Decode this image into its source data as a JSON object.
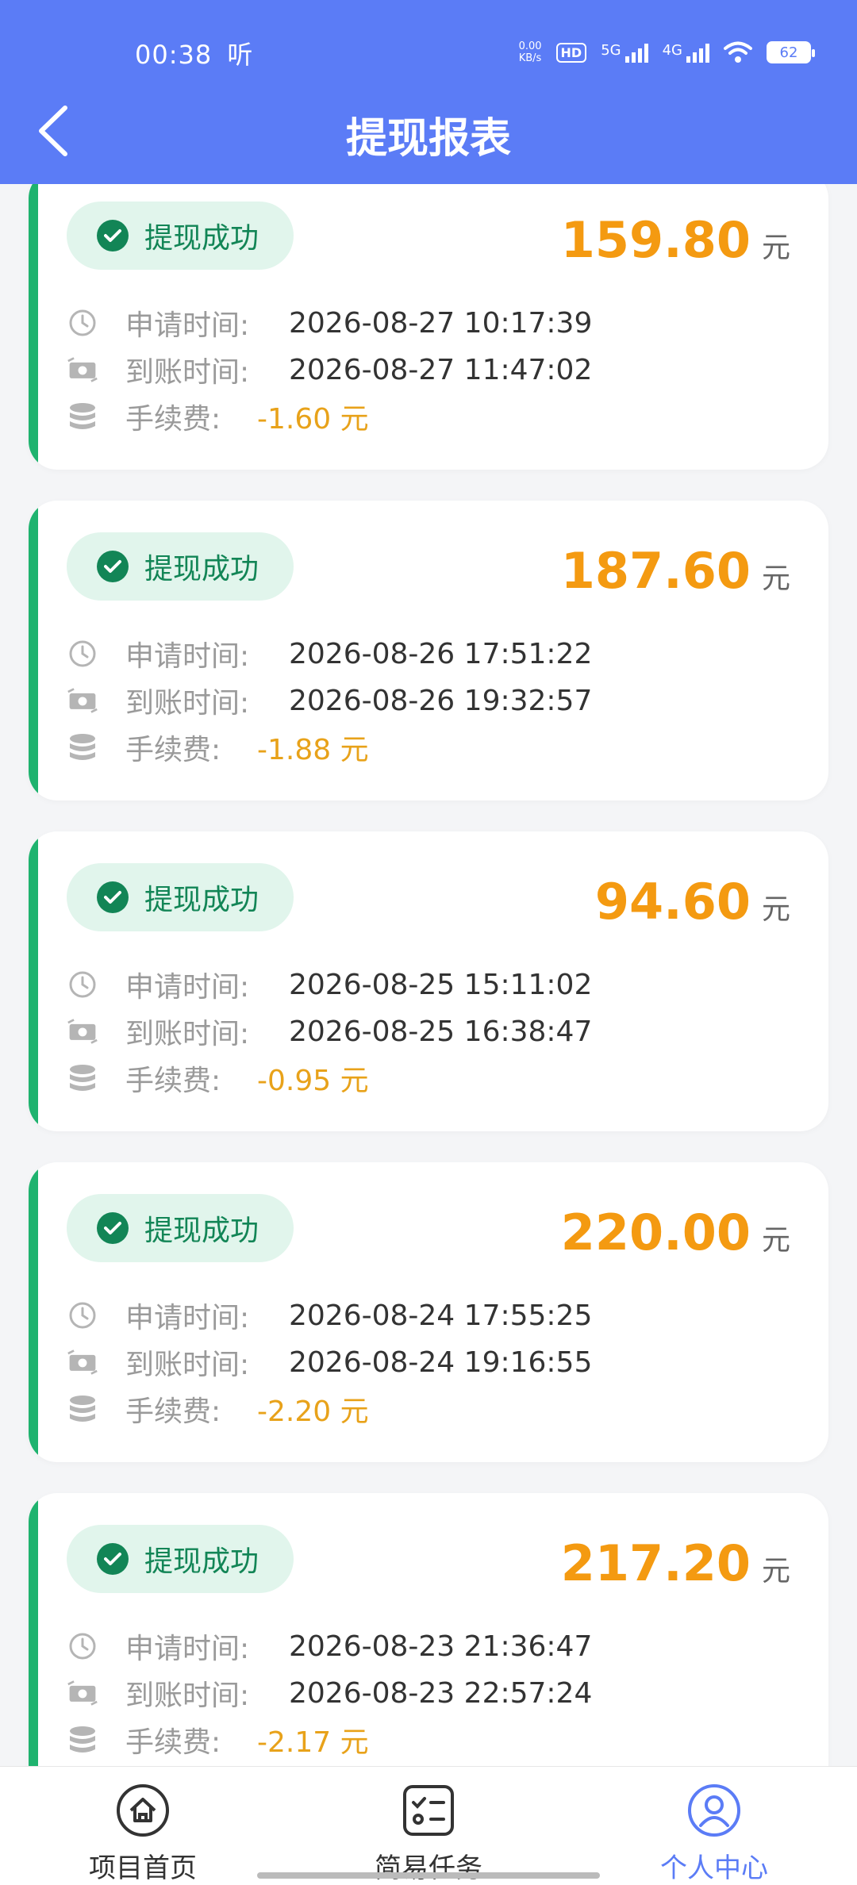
{
  "status_bar": {
    "time": "00:38",
    "extra": "听",
    "net_speed_top": "0.00",
    "net_speed_bottom": "KB/s",
    "hd_label": "HD",
    "sig1_label": "5G",
    "sig2_label": "4G",
    "battery": "62"
  },
  "header": {
    "title": "提现报表"
  },
  "labels": {
    "status": "提现成功",
    "apply_time": "申请时间:",
    "arrive_time": "到账时间:",
    "fee": "手续费:",
    "unit": "元"
  },
  "records": [
    {
      "amount": "159.80",
      "apply_time": "2026-08-27 10:17:39",
      "arrive_time": "2026-08-27 11:47:02",
      "fee": "-1.60 元"
    },
    {
      "amount": "187.60",
      "apply_time": "2026-08-26 17:51:22",
      "arrive_time": "2026-08-26 19:32:57",
      "fee": "-1.88 元"
    },
    {
      "amount": "94.60",
      "apply_time": "2026-08-25 15:11:02",
      "arrive_time": "2026-08-25 16:38:47",
      "fee": "-0.95 元"
    },
    {
      "amount": "220.00",
      "apply_time": "2026-08-24 17:55:25",
      "arrive_time": "2026-08-24 19:16:55",
      "fee": "-2.20 元"
    },
    {
      "amount": "217.20",
      "apply_time": "2026-08-23 21:36:47",
      "arrive_time": "2026-08-23 22:57:24",
      "fee": "-2.17 元"
    }
  ],
  "bottom_nav": [
    {
      "label": "项目首页",
      "icon": "home-icon"
    },
    {
      "label": "简易任务",
      "icon": "task-list-icon"
    },
    {
      "label": "个人中心",
      "icon": "user-icon",
      "active": true
    }
  ],
  "colors": {
    "primary": "#5b7cf6",
    "success": "#1fb36f",
    "amount": "#f49a11",
    "fee": "#e8a21a"
  }
}
